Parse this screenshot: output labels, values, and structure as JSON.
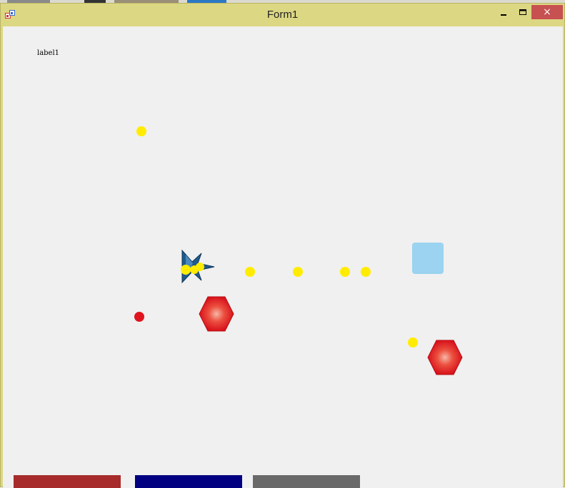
{
  "window": {
    "title": "Form1",
    "minimize_glyph": "–",
    "maximize_glyph": "□",
    "close_glyph": "×",
    "frame_color": "#dcd783",
    "close_color": "#c75050"
  },
  "form": {
    "label_text": "label1",
    "background": "#f0f0f0"
  },
  "game": {
    "player_ship": {
      "color": "#1f5a8c",
      "icon": "fighter-jet-icon"
    },
    "enemy_hexagons": {
      "count": 2,
      "color": "#e0141c",
      "icon": "red-hexagon-icon"
    },
    "powerup_square": {
      "color": "#9bd3f0",
      "icon": "light-blue-square-icon"
    },
    "bullets": {
      "count": 9,
      "color": "#ffec00"
    },
    "enemy_shot": {
      "count": 1,
      "color": "#e0141c"
    }
  },
  "buttons": [
    {
      "label": "",
      "color": "#a72b2b"
    },
    {
      "label": "",
      "color": "#000080"
    },
    {
      "label": "",
      "color": "#696969"
    }
  ]
}
